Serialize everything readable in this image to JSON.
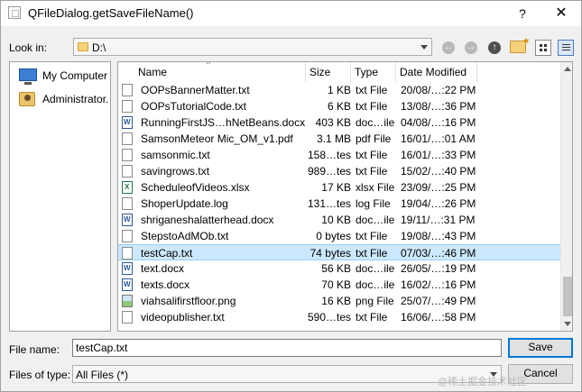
{
  "window": {
    "title": "QFileDialog.getSaveFileName()",
    "help": "?",
    "close": "✕"
  },
  "lookin": {
    "label": "Look in:",
    "path": "D:\\"
  },
  "sidebar": {
    "items": [
      {
        "label": "My Computer",
        "icon": "computer-icon"
      },
      {
        "label": "Administrator.",
        "icon": "user-folder-icon"
      }
    ]
  },
  "columns": {
    "name": "Name",
    "size": "Size",
    "type": "Type",
    "date": "Date Modified",
    "sort": "^"
  },
  "files": [
    {
      "name": "OOPsBannerMatter.txt",
      "size": "1 KB",
      "type": "txt File",
      "date": "20/08/…:22 PM",
      "icon": "txt"
    },
    {
      "name": "OOPsTutorialCode.txt",
      "size": "6 KB",
      "type": "txt File",
      "date": "13/08/…:36 PM",
      "icon": "txt"
    },
    {
      "name": "RunningFirstJS…hNetBeans.docx",
      "size": "403 KB",
      "type": "doc…ile",
      "date": "04/08/…:16 PM",
      "icon": "doc"
    },
    {
      "name": "SamsonMeteor Mic_OM_v1.pdf",
      "size": "3.1 MB",
      "type": "pdf File",
      "date": "16/01/…:01 AM",
      "icon": "pdf"
    },
    {
      "name": "samsonmic.txt",
      "size": "158…tes",
      "type": "txt File",
      "date": "16/01/…:33 PM",
      "icon": "txt"
    },
    {
      "name": "savingrows.txt",
      "size": "989…tes",
      "type": "txt File",
      "date": "15/02/…:40 PM",
      "icon": "txt"
    },
    {
      "name": "ScheduleofVideos.xlsx",
      "size": "17 KB",
      "type": "xlsx File",
      "date": "23/09/…:25 PM",
      "icon": "xls"
    },
    {
      "name": "ShoperUpdate.log",
      "size": "131…tes",
      "type": "log File",
      "date": "19/04/…:26 PM",
      "icon": "txt"
    },
    {
      "name": "shriganeshalatterhead.docx",
      "size": "10 KB",
      "type": "doc…ile",
      "date": "19/11/…:31 PM",
      "icon": "doc"
    },
    {
      "name": "StepstoAdMOb.txt",
      "size": "0 bytes",
      "type": "txt File",
      "date": "19/08/…:43 PM",
      "icon": "txt"
    },
    {
      "name": "testCap.txt",
      "size": "74 bytes",
      "type": "txt File",
      "date": "07/03/…:46 PM",
      "icon": "txt",
      "selected": true
    },
    {
      "name": "text.docx",
      "size": "56 KB",
      "type": "doc…ile",
      "date": "26/05/…:19 PM",
      "icon": "doc"
    },
    {
      "name": "texts.docx",
      "size": "70 KB",
      "type": "doc…ile",
      "date": "16/02/…:16 PM",
      "icon": "doc"
    },
    {
      "name": "viahsalifirstfloor.png",
      "size": "16 KB",
      "type": "png File",
      "date": "25/07/…:49 PM",
      "icon": "img"
    },
    {
      "name": "videopublisher.txt",
      "size": "590…tes",
      "type": "txt File",
      "date": "16/06/…:58 PM",
      "icon": "txt"
    }
  ],
  "filename": {
    "label": "File name:",
    "value": "testCap.txt"
  },
  "filetype": {
    "label": "Files of type:",
    "value": "All Files (*)"
  },
  "buttons": {
    "save": "Save",
    "cancel": "Cancel"
  },
  "watermark": "@稀土掘金技术社区"
}
